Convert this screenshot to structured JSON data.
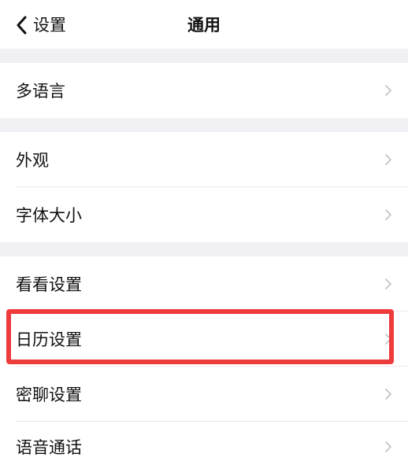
{
  "nav": {
    "back_label": "设置",
    "title": "通用"
  },
  "sections": [
    {
      "items": [
        {
          "label": "多语言"
        }
      ]
    },
    {
      "items": [
        {
          "label": "外观"
        },
        {
          "label": "字体大小"
        }
      ]
    },
    {
      "items": [
        {
          "label": "看看设置"
        },
        {
          "label": "日历设置"
        },
        {
          "label": "密聊设置"
        },
        {
          "label": "语音通话"
        }
      ]
    }
  ],
  "highlighted_item": "日历设置",
  "colors": {
    "background": "#ffffff",
    "section_gap": "#f0f0f5",
    "highlight_border": "#ee3b3b",
    "chevron": "#c4c4c6"
  },
  "icons": {
    "back": "chevron-left-icon",
    "row": "chevron-right-icon"
  }
}
